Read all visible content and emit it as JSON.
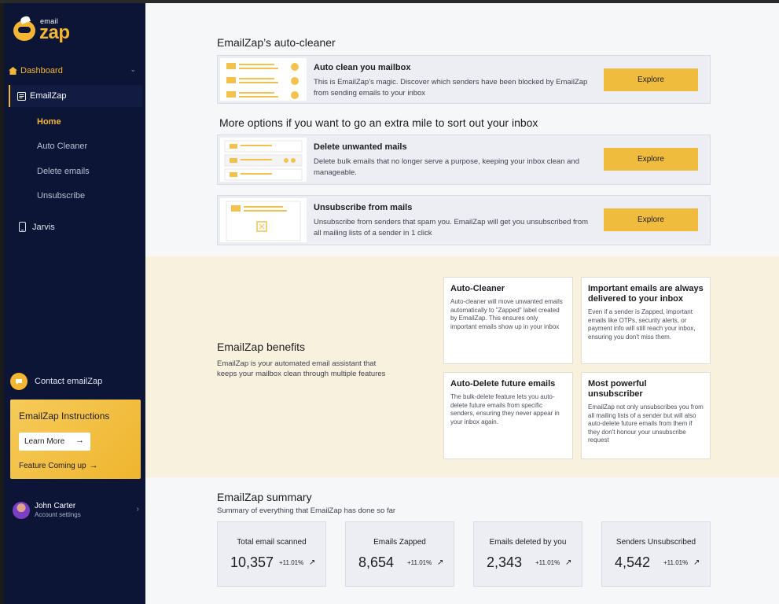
{
  "sidebar": {
    "logo": {
      "small": "email",
      "big": "zap"
    },
    "nav": {
      "dashboard": "Dashboard",
      "emailzap": "EmailZap",
      "sub": [
        "Home",
        "Auto Cleaner",
        "Delete emails",
        "Unsubscribe"
      ],
      "jarvis": "Jarvis"
    },
    "contact": "Contact emailZap",
    "promo": {
      "title": "EmailZap Instructions",
      "learn_more": "Learn More",
      "coming": "Feature Coming up"
    },
    "user": {
      "name": "John Carter",
      "subtitle": "Account settings"
    }
  },
  "main": {
    "autocleaner": {
      "title": "EmailZap’s auto-cleaner",
      "card": {
        "title": "Auto clean you mailbox",
        "desc": "This is EmailZap’s magic. Discover which senders have been blocked by EmailZap from sending emails to your inbox",
        "button": "Explore"
      }
    },
    "more": {
      "title": "More options if you want to go an extra mile to sort out your inbox",
      "cards": [
        {
          "title": "Delete unwanted mails",
          "desc": "Delete bulk emails that no longer serve a purpose, keeping your inbox clean and manageable.",
          "button": "Explore"
        },
        {
          "title": "Unsubscribe from mails",
          "desc": "Unsubscribe from senders that spam you. EmailZap will get you unsubscribed from all mailing lists of a sender in 1 click",
          "button": "Explore"
        }
      ]
    },
    "benefits": {
      "title": "EmailZap benefits",
      "desc": "EmailZap is your automated email assistant that keeps your mailbox clean through multiple features",
      "cards": [
        {
          "title": "Auto-Cleaner",
          "desc": "Auto-cleaner will move unwanted emails automatically to \"Zapped\" label created by EmailZap. This ensures only important emails show up in your inbox"
        },
        {
          "title": "Important emails are always delivered to your inbox",
          "desc": "Even if a sender is Zapped, important emails like OTPs, security alerts, or payment info will still reach your inbox, ensuring you don't miss them."
        },
        {
          "title": "Auto-Delete future emails",
          "desc": "The bulk-delete feature lets you auto-delete future emails from specific senders, ensuring they never appear in your inbox again."
        },
        {
          "title": "Most powerful unsubscriber",
          "desc": "EmailZap not only unsubscribes you from all mailing lists of a sender but will also auto-delete future emails from them if they don't honour your unsubscribe request"
        }
      ]
    },
    "summary": {
      "title": "EmailZap summary",
      "subtitle": "Summary of everything that EmailZap has done so far",
      "stats": [
        {
          "label": "Total email scanned",
          "value": "10,357",
          "change": "+11.01%"
        },
        {
          "label": "Emails Zapped",
          "value": "8,654",
          "change": "+11.01%"
        },
        {
          "label": "Emails deleted by you",
          "value": "2,343",
          "change": "+11.01%"
        },
        {
          "label": "Senders Unsubscribed",
          "value": "4,542",
          "change": "+11.01%"
        }
      ]
    }
  },
  "colors": {
    "sidebar_bg": "#0c1535",
    "accent": "#f2b632",
    "benefits_bg": "#f8f1de",
    "card_bg": "#eceef3"
  },
  "icons": {
    "dashboard": "home-icon",
    "emailzap": "document-icon",
    "jarvis": "phone-icon",
    "contact": "chat-icon",
    "trend": "trend-up-icon"
  }
}
